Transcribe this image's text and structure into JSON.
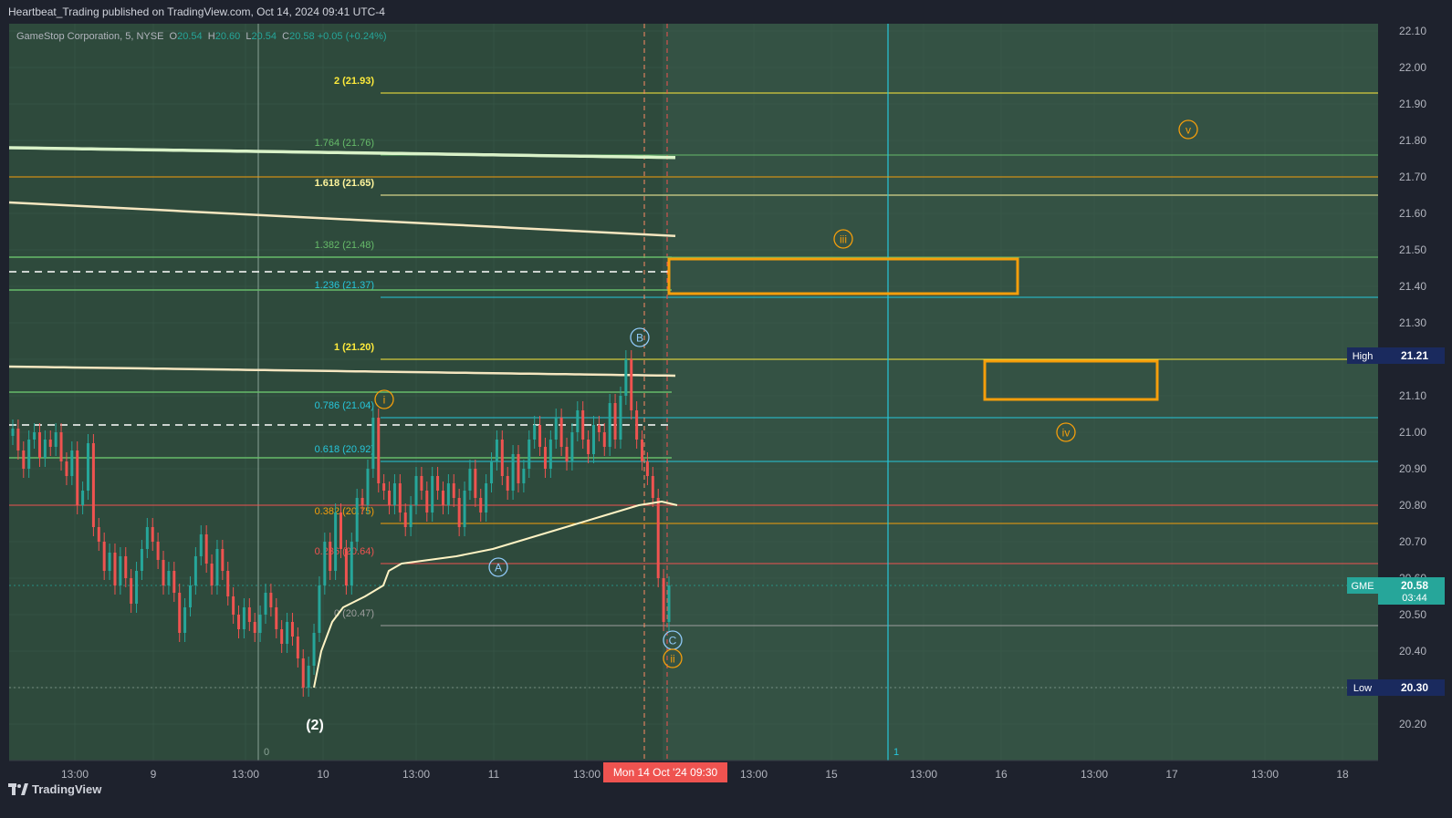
{
  "header": {
    "publisher_line": "Heartbeat_Trading published on TradingView.com, Oct 14, 2024 09:41 UTC-4"
  },
  "legend": {
    "symbol": "GameStop Corporation, 5, NYSE",
    "o_label": "O",
    "o": "20.54",
    "h_label": "H",
    "h": "20.60",
    "l_label": "L",
    "l": "20.54",
    "c_label": "C",
    "c": "20.58",
    "change": "+0.05 (+0.24%)"
  },
  "footer": {
    "brand": "TradingView",
    "brand_icon": "tradingview-logo-icon"
  },
  "colors": {
    "background": "#1e222d",
    "plot": "#2e4a3c",
    "up": "#26a69a",
    "down": "#ef5350",
    "orange": "#f59e0b",
    "yellow": "#ffeb3b",
    "green": "#66bb6a",
    "cyan": "#26c6da",
    "vwap": "#fff3c4",
    "ma": "#f5e6c0",
    "label_navy": "#1a2a5e"
  },
  "chart_data": {
    "type": "candlestick",
    "symbol": "GME",
    "timeframe": "5",
    "ylim": [
      20.1,
      22.12
    ],
    "y_ticks": [
      "22.10",
      "22.00",
      "21.90",
      "21.80",
      "21.70",
      "21.60",
      "21.50",
      "21.40",
      "21.30",
      "21.20",
      "21.10",
      "21.00",
      "20.90",
      "20.80",
      "20.70",
      "20.60",
      "20.50",
      "20.40",
      "20.30",
      "20.20"
    ],
    "x_ticks": [
      "13:00",
      "9",
      "13:00",
      "10",
      "13:00",
      "11",
      "13:00",
      "13:00",
      "15",
      "13:00",
      "16",
      "13:00",
      "17",
      "13:00",
      "18"
    ],
    "cursor_time_label": "Mon 14 Oct '24   09:30",
    "price_labels": [
      {
        "name": "High",
        "value": "21.21"
      },
      {
        "name": "GME",
        "value": "20.58",
        "sub": "03:44"
      },
      {
        "name": "Low",
        "value": "20.30"
      }
    ],
    "fibonacci_levels": [
      {
        "label": "2 (21.93)",
        "value": 21.93
      },
      {
        "label": "1.764 (21.76)",
        "value": 21.76
      },
      {
        "label": "1.618 (21.65)",
        "value": 21.65
      },
      {
        "label": "1.382 (21.48)",
        "value": 21.48
      },
      {
        "label": "1.236 (21.37)",
        "value": 21.37
      },
      {
        "label": "1 (21.20)",
        "value": 21.2
      },
      {
        "label": "0.786 (21.04)",
        "value": 21.04
      },
      {
        "label": "0.618 (20.92)",
        "value": 20.92
      },
      {
        "label": "0.382 (20.75)",
        "value": 20.75
      },
      {
        "label": "0.236 (20.64)",
        "value": 20.64
      },
      {
        "label": "0 (20.47)",
        "value": 20.47
      }
    ],
    "wave_labels": [
      "(2)",
      "i",
      "A",
      "B",
      "C",
      "ii",
      "iii",
      "iv",
      "v"
    ],
    "vertical_line_labels": [
      "0",
      "1"
    ],
    "target_boxes": [
      {
        "name": "wave-iii-target",
        "top": 21.475,
        "bottom": 21.38
      },
      {
        "name": "wave-iv-target",
        "top": 21.195,
        "bottom": 21.09
      }
    ],
    "price_series_close": [
      21.01,
      20.95,
      20.9,
      20.98,
      21.0,
      20.93,
      20.98,
      20.96,
      21.0,
      20.92,
      20.88,
      20.95,
      20.8,
      20.84,
      20.97,
      20.74,
      20.7,
      20.62,
      20.67,
      20.58,
      20.66,
      20.6,
      20.53,
      20.62,
      20.68,
      20.74,
      20.7,
      20.65,
      20.58,
      20.62,
      20.56,
      20.45,
      20.52,
      20.58,
      20.66,
      20.72,
      20.64,
      20.58,
      20.68,
      20.62,
      20.55,
      20.5,
      20.46,
      20.52,
      20.48,
      20.45,
      20.5,
      20.56,
      20.52,
      20.46,
      20.42,
      20.48,
      20.44,
      20.38,
      20.3,
      20.36,
      20.45,
      20.58,
      20.7,
      20.62,
      20.78,
      20.68,
      20.58,
      20.7,
      20.82,
      20.8,
      20.9,
      21.04,
      20.86,
      20.84,
      20.8,
      20.86,
      20.78,
      20.74,
      20.8,
      20.88,
      20.84,
      20.78,
      20.88,
      20.84,
      20.8,
      20.86,
      20.82,
      20.74,
      20.84,
      20.9,
      20.82,
      20.78,
      20.86,
      20.92,
      20.98,
      20.88,
      20.84,
      20.94,
      20.86,
      20.9,
      20.98,
      21.02,
      20.96,
      20.9,
      20.98,
      21.04,
      20.96,
      20.92,
      21.0,
      21.06,
      20.98,
      20.94,
      21.02,
      21.0,
      20.96,
      21.08,
      20.98,
      21.1,
      21.2,
      21.06,
      20.98,
      20.92,
      20.88,
      20.82,
      20.6,
      20.48,
      20.58
    ]
  }
}
